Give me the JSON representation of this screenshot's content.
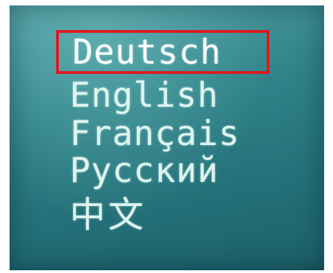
{
  "menu": {
    "selected_index": 0,
    "selection_color": "#e3141c",
    "text_color": "#dff4ef",
    "items": [
      {
        "label": "Deutsch"
      },
      {
        "label": "English"
      },
      {
        "label": "Français"
      },
      {
        "label": "Русский"
      },
      {
        "label": "中文"
      }
    ]
  }
}
